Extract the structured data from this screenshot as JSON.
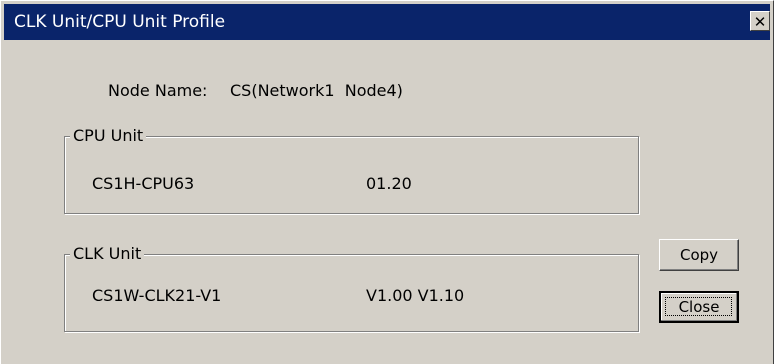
{
  "window": {
    "title": "CLK Unit/CPU Unit Profile",
    "close_glyph": "✕"
  },
  "node": {
    "label": "Node Name:",
    "value": "CS(Network1  Node4)"
  },
  "cpu_unit": {
    "group_label": "CPU Unit",
    "model": "CS1H-CPU63",
    "version": "01.20"
  },
  "clk_unit": {
    "group_label": "CLK Unit",
    "model": "CS1W-CLK21-V1",
    "version": "V1.00 V1.10"
  },
  "buttons": {
    "copy": "Copy",
    "close": "Close"
  }
}
